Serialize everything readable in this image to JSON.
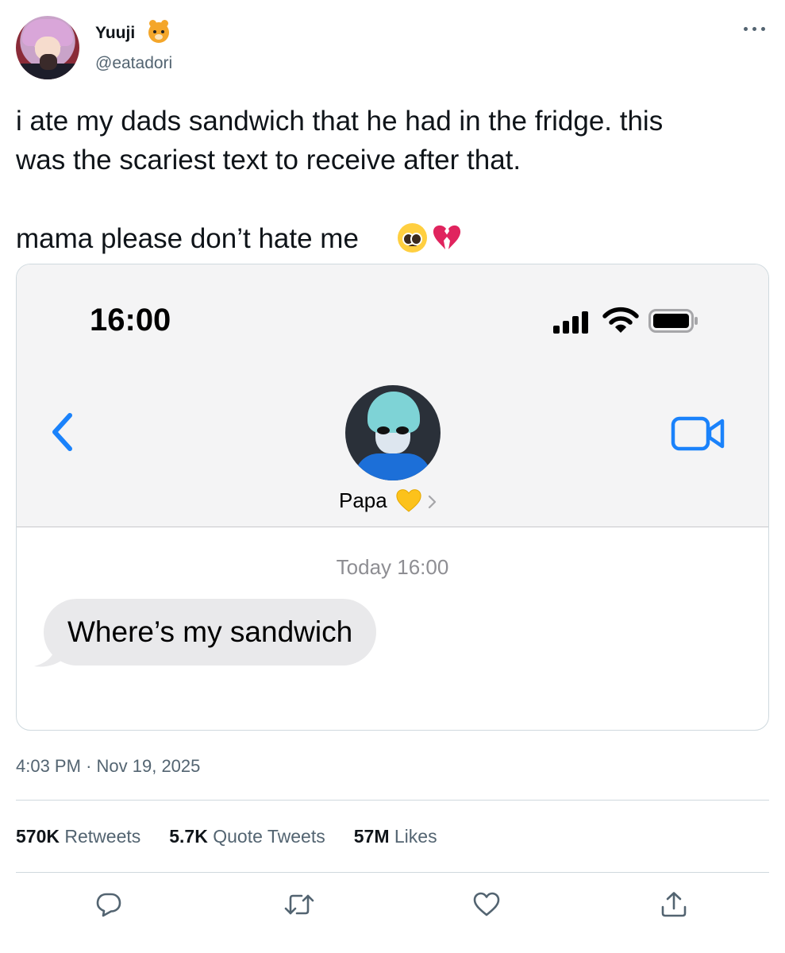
{
  "author": {
    "name": "Yuuji",
    "name_emoji": "tiger-face-icon",
    "handle": "@eatadori"
  },
  "tweet": {
    "text_lines": [
      "i ate my dads sandwich that he had in the fridge. this",
      "was the scariest text to receive after that."
    ],
    "text_line3": "mama please don’t hate me",
    "trailing_emojis": [
      "pleading-face-icon",
      "broken-heart-icon"
    ]
  },
  "embedded_screenshot": {
    "status_time": "16:00",
    "contact_name": "Papa",
    "contact_emoji": "yellow-heart-icon",
    "message_timestamp": "Today 16:00",
    "message_text": "Where’s my sandwich"
  },
  "meta": {
    "time": "4:03 PM",
    "separator": "·",
    "date": "Nov 19, 2025"
  },
  "stats": {
    "retweets_count": "570K",
    "retweets_label": "Retweets",
    "quotes_count": "5.7K",
    "quotes_label": "Quote Tweets",
    "likes_count": "57M",
    "likes_label": "Likes"
  },
  "actions": [
    "reply-icon",
    "retweet-icon",
    "like-icon",
    "share-icon"
  ],
  "colors": {
    "text": "#0f1419",
    "secondary": "#536471",
    "ios_blue": "#1a82fb",
    "bubble": "#e9e9eb",
    "divider": "#cfd9de"
  }
}
